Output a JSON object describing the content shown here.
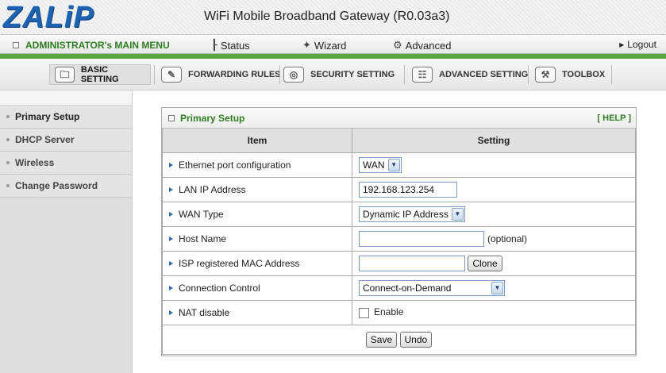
{
  "header": {
    "logo": "ZALiP",
    "title": "WiFi Mobile Broadband Gateway (R0.03a3)"
  },
  "top_menu": {
    "admin_menu": "ADMINISTRATOR's MAIN MENU",
    "status": "Status",
    "wizard": "Wizard",
    "advanced": "Advanced",
    "logout": "Logout"
  },
  "nav_tabs": [
    {
      "label": "BASIC SETTING",
      "active": true,
      "icon": "folder-icon"
    },
    {
      "label": "FORWARDING RULES",
      "active": false,
      "icon": "pen-icon"
    },
    {
      "label": "SECURITY SETTING",
      "active": false,
      "icon": "disc-icon"
    },
    {
      "label": "ADVANCED SETTING",
      "active": false,
      "icon": "network-icon"
    },
    {
      "label": "TOOLBOX",
      "active": false,
      "icon": "toolbox-icon"
    }
  ],
  "sidebar": {
    "items": [
      {
        "label": "Primary Setup",
        "active": true
      },
      {
        "label": "DHCP Server",
        "active": false
      },
      {
        "label": "Wireless",
        "active": false
      },
      {
        "label": "Change Password",
        "active": false
      }
    ]
  },
  "panel": {
    "title": "Primary Setup",
    "help": "[ HELP ]",
    "col_item": "Item",
    "col_setting": "Setting"
  },
  "rows": {
    "ethernet": {
      "label": "Ethernet port configuration",
      "value": "WAN"
    },
    "lan_ip": {
      "label": "LAN IP Address",
      "value": "192.168.123.254"
    },
    "wan_type": {
      "label": "WAN Type",
      "value": "Dynamic IP Address"
    },
    "host_name": {
      "label": "Host Name",
      "value": "",
      "suffix": "(optional)"
    },
    "mac": {
      "label": "ISP registered MAC Address",
      "value": "",
      "button": "Clone"
    },
    "connection": {
      "label": "Connection Control",
      "value": "Connect-on-Demand"
    },
    "nat": {
      "label": "NAT disable",
      "checkbox_label": "Enable",
      "checked": false
    }
  },
  "actions": {
    "save": "Save",
    "undo": "Undo"
  },
  "colors": {
    "brand_blue": "#1d63b2",
    "accent_green": "#2f7d22",
    "green_strip": "#5aa640"
  }
}
